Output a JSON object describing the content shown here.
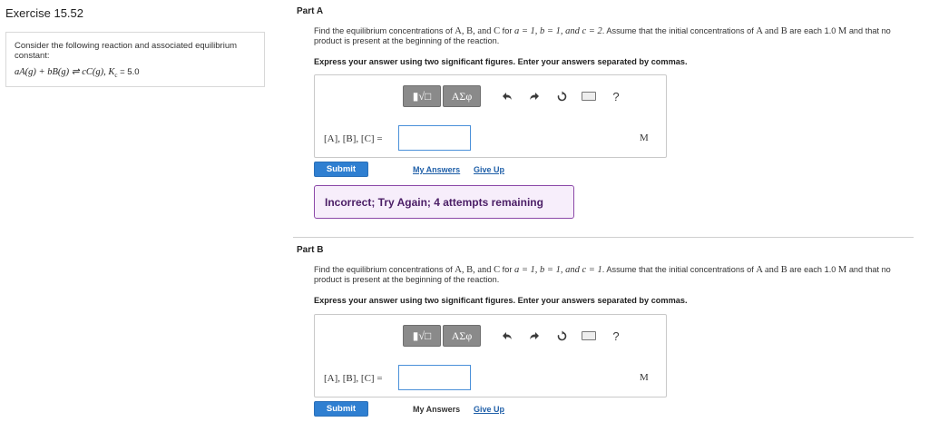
{
  "exercise": {
    "title": "Exercise 15.52",
    "intro": "Consider the following reaction and associated equilibrium constant:",
    "equation": "aA(g) + bB(g) ⇌ cC(g),",
    "kc_symbol": "K",
    "kc_sub": "c",
    "kc_value": "= 5.0"
  },
  "parts": [
    {
      "label": "Part A",
      "prompt_before": "Find the equilibrium concentrations of ",
      "prompt_species": "A, B, and C",
      "prompt_for": " for ",
      "prompt_coeffs": "a = 1, b = 1, and c = 2",
      "prompt_after": ". Assume that the initial concentrations of ",
      "prompt_ab": "A and B",
      "prompt_after2": " are each 1.0 ",
      "prompt_unit": "M",
      "prompt_end": " and that no product is present at the beginning of the reaction.",
      "instruction": "Express your answer using two significant figures. Enter your answers separated by commas.",
      "answer_label": "[A], [B], [C] =",
      "answer_value": "",
      "unit": "M",
      "submit": "Submit",
      "my_answers": "My Answers",
      "give_up": "Give Up",
      "feedback": "Incorrect; Try Again; 4 attempts remaining"
    },
    {
      "label": "Part B",
      "prompt_before": "Find the equilibrium concentrations of ",
      "prompt_species": "A, B, and C",
      "prompt_for": " for ",
      "prompt_coeffs": "a = 1, b = 1, and c = 1",
      "prompt_after": ". Assume that the initial concentrations of ",
      "prompt_ab": "A and B",
      "prompt_after2": " are each 1.0 ",
      "prompt_unit": "M",
      "prompt_end": " and that no product is present at the beginning of the reaction.",
      "instruction": "Express your answer using two significant figures. Enter your answers separated by commas.",
      "answer_label": "[A], [B], [C] =",
      "answer_value": "",
      "unit": "M",
      "submit": "Submit",
      "my_answers": "My Answers",
      "give_up": "Give Up"
    }
  ],
  "toolbar": {
    "templates_label": "▮√□",
    "symbols_label": "ΑΣφ",
    "undo_icon": "undo-icon",
    "redo_icon": "redo-icon",
    "reset_icon": "reset-icon",
    "keyboard_icon": "keyboard-icon",
    "help_label": "?"
  }
}
